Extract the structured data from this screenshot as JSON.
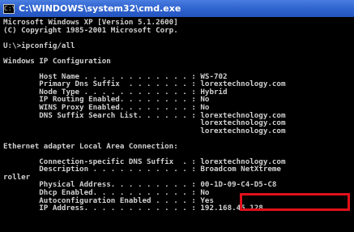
{
  "window": {
    "title": "C:\\WINDOWS\\system32\\cmd.exe",
    "icon": "cmd-icon"
  },
  "console_lines": [
    "Microsoft Windows XP [Version 5.1.2600]",
    "(C) Copyright 1985-2001 Microsoft Corp.",
    "",
    "U:\\>ipconfig/all",
    "",
    "Windows IP Configuration",
    "",
    "        Host Name . . . . . . . . . . . . : WS-702",
    "        Primary Dns Suffix  . . . . . . . : lorextechnology.com",
    "        Node Type . . . . . . . . . . . . : Hybrid",
    "        IP Routing Enabled. . . . . . . . : No",
    "        WINS Proxy Enabled. . . . . . . . : No",
    "        DNS Suffix Search List. . . . . . : lorextechnology.com",
    "                                            lorextechnology.com",
    "                                            lorextechnology.com",
    "",
    "Ethernet adapter Local Area Connection:",
    "",
    "        Connection-specific DNS Suffix  . : lorextechnology.com",
    "        Description . . . . . . . . . . . : Broadcom NetXtreme",
    "roller",
    "        Physical Address. . . . . . . . . : 00-1D-09-C4-D5-C8",
    "        Dhcp Enabled. . . . . . . . . . . : No",
    "        Autoconfiguration Enabled . . . . : Yes",
    "        IP Address. . . . . . . . . . . . : 192.168.45.128"
  ],
  "highlight_color": "#e0101a"
}
